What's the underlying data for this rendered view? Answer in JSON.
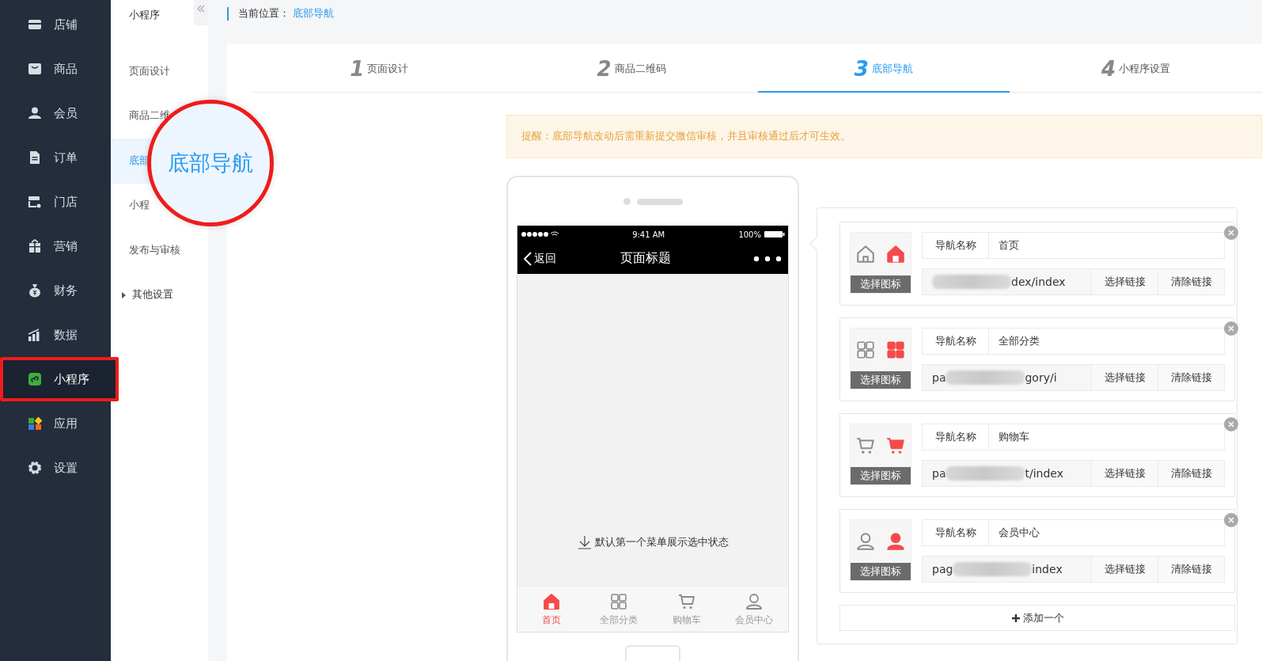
{
  "sidebar": {
    "items": [
      {
        "label": "店铺",
        "selected": false,
        "highlighted": false
      },
      {
        "label": "商品",
        "selected": false,
        "highlighted": false
      },
      {
        "label": "会员",
        "selected": false,
        "highlighted": false
      },
      {
        "label": "订单",
        "selected": false,
        "highlighted": false
      },
      {
        "label": "门店",
        "selected": false,
        "highlighted": false
      },
      {
        "label": "营销",
        "selected": false,
        "highlighted": false
      },
      {
        "label": "财务",
        "selected": false,
        "highlighted": false
      },
      {
        "label": "数据",
        "selected": false,
        "highlighted": false
      },
      {
        "label": "小程序",
        "selected": true,
        "highlighted": true
      },
      {
        "label": "应用",
        "selected": false,
        "highlighted": false
      },
      {
        "label": "设置",
        "selected": false,
        "highlighted": false
      }
    ]
  },
  "subnav": {
    "title": "小程序",
    "items": [
      {
        "label": "页面设计",
        "kind": "link",
        "selected": false
      },
      {
        "label": "商品二维",
        "kind": "link",
        "selected": false
      },
      {
        "label": "底部",
        "kind": "link",
        "selected": true
      },
      {
        "label": "小程",
        "kind": "link",
        "selected": false
      },
      {
        "label": "发布与审核",
        "kind": "link",
        "selected": false
      },
      {
        "label": "其他设置",
        "kind": "group",
        "selected": false
      }
    ]
  },
  "magnifier": {
    "text": "底部导航"
  },
  "breadcrumb": {
    "label": "当前位置：",
    "current": "底部导航"
  },
  "steps": [
    {
      "number": "1",
      "label": "页面设计",
      "selected": false
    },
    {
      "number": "2",
      "label": "商品二维码",
      "selected": false
    },
    {
      "number": "3",
      "label": "底部导航",
      "selected": true
    },
    {
      "number": "4",
      "label": "小程序设置",
      "selected": false
    }
  ],
  "notice": "提醒：底部导航改动后需重新提交微信审核，并且审核通过后才可生效。",
  "phone": {
    "time": "9:41 AM",
    "battery": "100%",
    "back": "返回",
    "title": "页面标题",
    "hint": "默认第一个菜单展示选中状态",
    "tabs": [
      {
        "label": "首页",
        "selected": true
      },
      {
        "label": "全部分类",
        "selected": false
      },
      {
        "label": "购物车",
        "selected": false
      },
      {
        "label": "会员中心",
        "selected": false
      }
    ]
  },
  "nav_items": [
    {
      "name_label": "导航名称",
      "name": "首页",
      "choose_icon": "选择图标",
      "link_end": "dex/index",
      "choose_link": "选择链接",
      "clear_link": "清除链接"
    },
    {
      "name_label": "导航名称",
      "name": "全部分类",
      "choose_icon": "选择图标",
      "link_start": "pa",
      "link_end": "gory/i",
      "choose_link": "选择链接",
      "clear_link": "清除链接"
    },
    {
      "name_label": "导航名称",
      "name": "购物车",
      "choose_icon": "选择图标",
      "link_start": "pa",
      "link_end": "t/index",
      "choose_link": "选择链接",
      "clear_link": "清除链接"
    },
    {
      "name_label": "导航名称",
      "name": "会员中心",
      "choose_icon": "选择图标",
      "link_start": "pag",
      "link_end": "index",
      "choose_link": "选择链接",
      "clear_link": "清除链接"
    }
  ],
  "add_button": "添加一个"
}
